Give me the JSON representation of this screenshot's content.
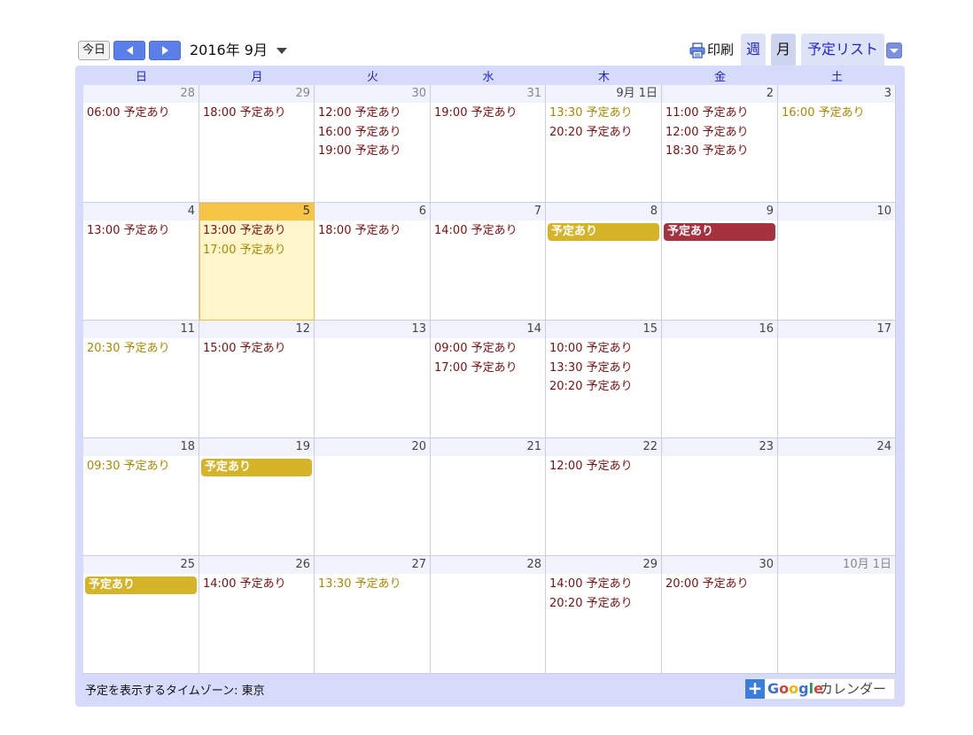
{
  "toolbar": {
    "today_label": "今日",
    "month_title": "2016年 9月",
    "print_label": "印刷",
    "tabs": [
      {
        "label": "週"
      },
      {
        "label": "月"
      },
      {
        "label": "予定リスト"
      }
    ]
  },
  "weekdays": [
    "日",
    "月",
    "火",
    "水",
    "木",
    "金",
    "土"
  ],
  "weeks": [
    [
      {
        "day": "28",
        "other": true,
        "events": [
          {
            "time": "06:00",
            "title": "予定あり",
            "color": "maroon"
          }
        ]
      },
      {
        "day": "29",
        "other": true,
        "events": [
          {
            "time": "18:00",
            "title": "予定あり",
            "color": "maroon"
          }
        ]
      },
      {
        "day": "30",
        "other": true,
        "events": [
          {
            "time": "12:00",
            "title": "予定あり",
            "color": "maroon"
          },
          {
            "time": "16:00",
            "title": "予定あり",
            "color": "maroon"
          },
          {
            "time": "19:00",
            "title": "予定あり",
            "color": "maroon"
          }
        ]
      },
      {
        "day": "31",
        "other": true,
        "events": [
          {
            "time": "19:00",
            "title": "予定あり",
            "color": "maroon"
          }
        ]
      },
      {
        "day": "9月 1日",
        "events": [
          {
            "time": "13:30",
            "title": "予定あり",
            "color": "gold"
          },
          {
            "time": "20:20",
            "title": "予定あり",
            "color": "maroon"
          }
        ]
      },
      {
        "day": "2",
        "events": [
          {
            "time": "11:00",
            "title": "予定あり",
            "color": "maroon"
          },
          {
            "time": "12:00",
            "title": "予定あり",
            "color": "maroon"
          },
          {
            "time": "18:30",
            "title": "予定あり",
            "color": "maroon"
          }
        ]
      },
      {
        "day": "3",
        "events": [
          {
            "time": "16:00",
            "title": "予定あり",
            "color": "gold"
          }
        ]
      }
    ],
    [
      {
        "day": "4",
        "events": [
          {
            "time": "13:00",
            "title": "予定あり",
            "color": "maroon"
          }
        ]
      },
      {
        "day": "5",
        "today": true,
        "events": [
          {
            "time": "13:00",
            "title": "予定あり",
            "color": "maroon"
          },
          {
            "time": "17:00",
            "title": "予定あり",
            "color": "gold"
          }
        ]
      },
      {
        "day": "6",
        "events": [
          {
            "time": "18:00",
            "title": "予定あり",
            "color": "maroon"
          }
        ]
      },
      {
        "day": "7",
        "events": [
          {
            "time": "14:00",
            "title": "予定あり",
            "color": "maroon"
          }
        ]
      },
      {
        "day": "8",
        "events": [
          {
            "allday": true,
            "title": "予定あり",
            "color": "gold"
          }
        ]
      },
      {
        "day": "9",
        "events": [
          {
            "allday": true,
            "title": "予定あり",
            "color": "red"
          }
        ]
      },
      {
        "day": "10",
        "events": []
      }
    ],
    [
      {
        "day": "11",
        "events": [
          {
            "time": "20:30",
            "title": "予定あり",
            "color": "gold"
          }
        ]
      },
      {
        "day": "12",
        "events": [
          {
            "time": "15:00",
            "title": "予定あり",
            "color": "maroon"
          }
        ]
      },
      {
        "day": "13",
        "events": []
      },
      {
        "day": "14",
        "events": [
          {
            "time": "09:00",
            "title": "予定あり",
            "color": "maroon"
          },
          {
            "time": "17:00",
            "title": "予定あり",
            "color": "maroon"
          }
        ]
      },
      {
        "day": "15",
        "events": [
          {
            "time": "10:00",
            "title": "予定あり",
            "color": "maroon"
          },
          {
            "time": "13:30",
            "title": "予定あり",
            "color": "maroon"
          },
          {
            "time": "20:20",
            "title": "予定あり",
            "color": "maroon"
          }
        ]
      },
      {
        "day": "16",
        "events": []
      },
      {
        "day": "17",
        "events": []
      }
    ],
    [
      {
        "day": "18",
        "events": [
          {
            "time": "09:30",
            "title": "予定あり",
            "color": "gold"
          }
        ]
      },
      {
        "day": "19",
        "events": [
          {
            "allday": true,
            "title": "予定あり",
            "color": "gold"
          }
        ]
      },
      {
        "day": "20",
        "events": []
      },
      {
        "day": "21",
        "events": []
      },
      {
        "day": "22",
        "events": [
          {
            "time": "12:00",
            "title": "予定あり",
            "color": "maroon"
          }
        ]
      },
      {
        "day": "23",
        "events": []
      },
      {
        "day": "24",
        "events": []
      }
    ],
    [
      {
        "day": "25",
        "events": [
          {
            "allday": true,
            "title": "予定あり",
            "color": "gold"
          }
        ]
      },
      {
        "day": "26",
        "events": [
          {
            "time": "14:00",
            "title": "予定あり",
            "color": "maroon"
          }
        ]
      },
      {
        "day": "27",
        "events": [
          {
            "time": "13:30",
            "title": "予定あり",
            "color": "gold"
          }
        ]
      },
      {
        "day": "28",
        "events": []
      },
      {
        "day": "29",
        "events": [
          {
            "time": "14:00",
            "title": "予定あり",
            "color": "maroon"
          },
          {
            "time": "20:20",
            "title": "予定あり",
            "color": "maroon"
          }
        ]
      },
      {
        "day": "30",
        "events": [
          {
            "time": "20:00",
            "title": "予定あり",
            "color": "maroon"
          }
        ]
      },
      {
        "day": "10月 1日",
        "other": true,
        "events": []
      }
    ]
  ],
  "footer": {
    "timezone_label": "予定を表示するタイムゾーン: 東京",
    "badge_plus": "+",
    "badge_google_letters": [
      "G",
      "o",
      "o",
      "g",
      "l",
      "e"
    ],
    "badge_text": "カレンダー"
  },
  "colors": {
    "maroon": "#7a1010",
    "gold": "#a98900",
    "gold_bar": "#d6b42a",
    "red_bar": "#a6323f",
    "today_head": "#f6c545",
    "today_bg": "#fef5cb",
    "frame": "#d6dbfb"
  },
  "icons": {
    "prev": "chevron-left-icon",
    "next": "chevron-right-icon",
    "month_dropdown": "caret-down-icon",
    "print": "printer-icon",
    "agenda_dropdown": "caret-down-icon"
  }
}
